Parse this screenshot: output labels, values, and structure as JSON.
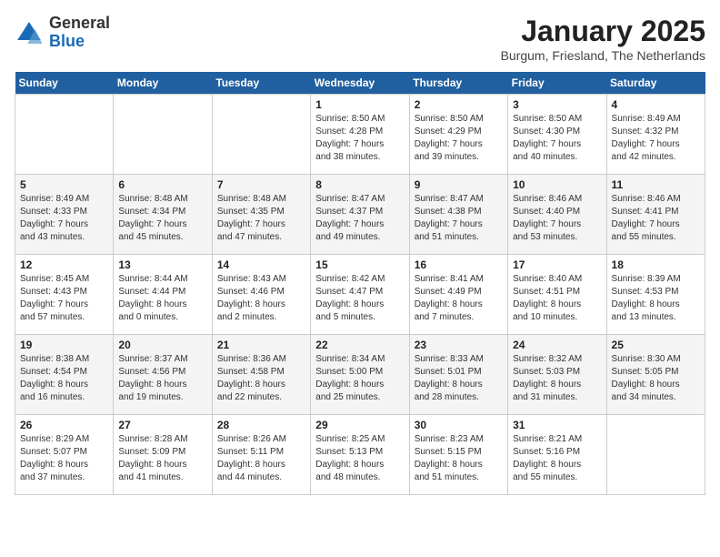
{
  "header": {
    "logo_general": "General",
    "logo_blue": "Blue",
    "title": "January 2025",
    "subtitle": "Burgum, Friesland, The Netherlands"
  },
  "weekdays": [
    "Sunday",
    "Monday",
    "Tuesday",
    "Wednesday",
    "Thursday",
    "Friday",
    "Saturday"
  ],
  "weeks": [
    [
      {
        "day": "",
        "info": ""
      },
      {
        "day": "",
        "info": ""
      },
      {
        "day": "",
        "info": ""
      },
      {
        "day": "1",
        "info": "Sunrise: 8:50 AM\nSunset: 4:28 PM\nDaylight: 7 hours\nand 38 minutes."
      },
      {
        "day": "2",
        "info": "Sunrise: 8:50 AM\nSunset: 4:29 PM\nDaylight: 7 hours\nand 39 minutes."
      },
      {
        "day": "3",
        "info": "Sunrise: 8:50 AM\nSunset: 4:30 PM\nDaylight: 7 hours\nand 40 minutes."
      },
      {
        "day": "4",
        "info": "Sunrise: 8:49 AM\nSunset: 4:32 PM\nDaylight: 7 hours\nand 42 minutes."
      }
    ],
    [
      {
        "day": "5",
        "info": "Sunrise: 8:49 AM\nSunset: 4:33 PM\nDaylight: 7 hours\nand 43 minutes."
      },
      {
        "day": "6",
        "info": "Sunrise: 8:48 AM\nSunset: 4:34 PM\nDaylight: 7 hours\nand 45 minutes."
      },
      {
        "day": "7",
        "info": "Sunrise: 8:48 AM\nSunset: 4:35 PM\nDaylight: 7 hours\nand 47 minutes."
      },
      {
        "day": "8",
        "info": "Sunrise: 8:47 AM\nSunset: 4:37 PM\nDaylight: 7 hours\nand 49 minutes."
      },
      {
        "day": "9",
        "info": "Sunrise: 8:47 AM\nSunset: 4:38 PM\nDaylight: 7 hours\nand 51 minutes."
      },
      {
        "day": "10",
        "info": "Sunrise: 8:46 AM\nSunset: 4:40 PM\nDaylight: 7 hours\nand 53 minutes."
      },
      {
        "day": "11",
        "info": "Sunrise: 8:46 AM\nSunset: 4:41 PM\nDaylight: 7 hours\nand 55 minutes."
      }
    ],
    [
      {
        "day": "12",
        "info": "Sunrise: 8:45 AM\nSunset: 4:43 PM\nDaylight: 7 hours\nand 57 minutes."
      },
      {
        "day": "13",
        "info": "Sunrise: 8:44 AM\nSunset: 4:44 PM\nDaylight: 8 hours\nand 0 minutes."
      },
      {
        "day": "14",
        "info": "Sunrise: 8:43 AM\nSunset: 4:46 PM\nDaylight: 8 hours\nand 2 minutes."
      },
      {
        "day": "15",
        "info": "Sunrise: 8:42 AM\nSunset: 4:47 PM\nDaylight: 8 hours\nand 5 minutes."
      },
      {
        "day": "16",
        "info": "Sunrise: 8:41 AM\nSunset: 4:49 PM\nDaylight: 8 hours\nand 7 minutes."
      },
      {
        "day": "17",
        "info": "Sunrise: 8:40 AM\nSunset: 4:51 PM\nDaylight: 8 hours\nand 10 minutes."
      },
      {
        "day": "18",
        "info": "Sunrise: 8:39 AM\nSunset: 4:53 PM\nDaylight: 8 hours\nand 13 minutes."
      }
    ],
    [
      {
        "day": "19",
        "info": "Sunrise: 8:38 AM\nSunset: 4:54 PM\nDaylight: 8 hours\nand 16 minutes."
      },
      {
        "day": "20",
        "info": "Sunrise: 8:37 AM\nSunset: 4:56 PM\nDaylight: 8 hours\nand 19 minutes."
      },
      {
        "day": "21",
        "info": "Sunrise: 8:36 AM\nSunset: 4:58 PM\nDaylight: 8 hours\nand 22 minutes."
      },
      {
        "day": "22",
        "info": "Sunrise: 8:34 AM\nSunset: 5:00 PM\nDaylight: 8 hours\nand 25 minutes."
      },
      {
        "day": "23",
        "info": "Sunrise: 8:33 AM\nSunset: 5:01 PM\nDaylight: 8 hours\nand 28 minutes."
      },
      {
        "day": "24",
        "info": "Sunrise: 8:32 AM\nSunset: 5:03 PM\nDaylight: 8 hours\nand 31 minutes."
      },
      {
        "day": "25",
        "info": "Sunrise: 8:30 AM\nSunset: 5:05 PM\nDaylight: 8 hours\nand 34 minutes."
      }
    ],
    [
      {
        "day": "26",
        "info": "Sunrise: 8:29 AM\nSunset: 5:07 PM\nDaylight: 8 hours\nand 37 minutes."
      },
      {
        "day": "27",
        "info": "Sunrise: 8:28 AM\nSunset: 5:09 PM\nDaylight: 8 hours\nand 41 minutes."
      },
      {
        "day": "28",
        "info": "Sunrise: 8:26 AM\nSunset: 5:11 PM\nDaylight: 8 hours\nand 44 minutes."
      },
      {
        "day": "29",
        "info": "Sunrise: 8:25 AM\nSunset: 5:13 PM\nDaylight: 8 hours\nand 48 minutes."
      },
      {
        "day": "30",
        "info": "Sunrise: 8:23 AM\nSunset: 5:15 PM\nDaylight: 8 hours\nand 51 minutes."
      },
      {
        "day": "31",
        "info": "Sunrise: 8:21 AM\nSunset: 5:16 PM\nDaylight: 8 hours\nand 55 minutes."
      },
      {
        "day": "",
        "info": ""
      }
    ]
  ]
}
